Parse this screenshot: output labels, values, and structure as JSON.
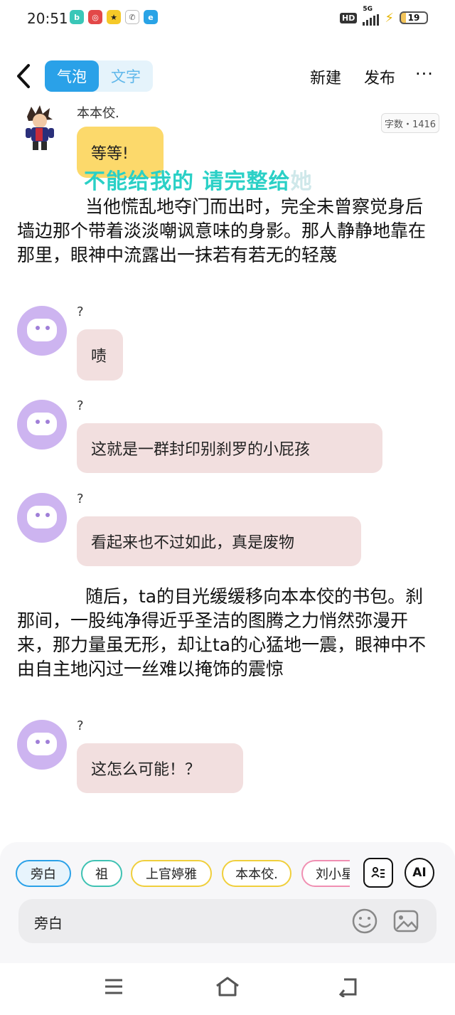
{
  "status_bar": {
    "time": "20:51",
    "network": "HD",
    "signal_label": "5G",
    "battery": "19"
  },
  "header": {
    "tab_bubble": "气泡",
    "tab_text": "文字",
    "new_label": "新建",
    "publish_label": "发布",
    "more_label": "···"
  },
  "messages": {
    "first_name": "本本佼.",
    "first_text": "等等!",
    "word_count": "字数・1416",
    "overlay_text": "不能给我的 请完整给",
    "overlay_faint": "她",
    "narration1": "当他慌乱地夺门而出时，完全未曾察觉身后墙边那个带着淡淡嘲讽意味的身影。那人静静地靠在那里，眼神中流露出一抹若有若无的轻蔑",
    "msg1_name": "?",
    "msg1_text": "啧",
    "msg2_name": "?",
    "msg2_text": "这就是一群封印别刹罗的小屁孩",
    "msg3_name": "?",
    "msg3_text": "看起来也不过如此，真是废物",
    "narration2": "随后，ta的目光缓缓移向本本佼的书包。刹那间，一股纯净得近乎圣洁的图腾之力悄然弥漫开来，那力量虽无形，却让ta的心猛地一震，眼神中不由自主地闪过一丝难以掩饰的震惊",
    "msg4_name": "?",
    "msg4_text": "这怎么可能！？"
  },
  "toolbar": {
    "chips": [
      "旁白",
      "祖",
      "上官婷雅",
      "本本佼.",
      "刘小星"
    ],
    "ai_label": "AI",
    "input_value": "旁白"
  },
  "colors": {
    "accent": "#2aa1e8",
    "bubble_yellow": "#fcd96b",
    "bubble_pink": "#f2dfdf",
    "avatar_purple": "#cdb4f0"
  }
}
